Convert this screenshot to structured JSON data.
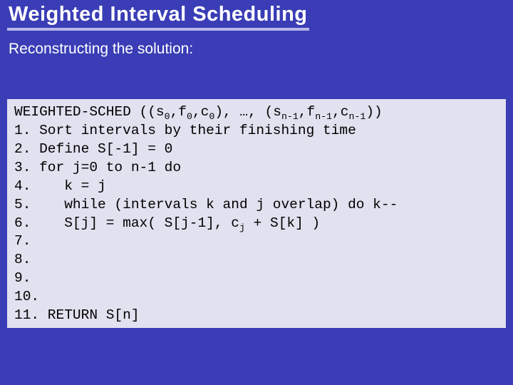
{
  "title": "Weighted Interval Scheduling",
  "subtitle": "Reconstructing the solution:",
  "code": {
    "header_pre": "WEIGHTED-SCHED ((s",
    "header_s0a": "0",
    "header_mid1": ",f",
    "header_s0b": "0",
    "header_mid2": ",c",
    "header_s0c": "0",
    "header_mid3": "), …, (s",
    "header_sn1a": "n-1",
    "header_mid4": ",f",
    "header_sn1b": "n-1",
    "header_mid5": ",c",
    "header_sn1c": "n-1",
    "header_post": "))",
    "l1": "1. Sort intervals by their finishing time",
    "l2": "2. Define S[-1] = 0",
    "l3": "3. for j=0 to n-1 do",
    "l4": "4.    k = j",
    "l5": "5.    while (intervals k and j overlap) do k--",
    "l6pre": "6.    S[j] = max( S[j-1], c",
    "l6sub": "j",
    "l6post": " + S[k] )",
    "l7": "7.",
    "l8": "8.",
    "l9": "9.",
    "l10": "10.",
    "l11": "11. RETURN S[n]"
  }
}
